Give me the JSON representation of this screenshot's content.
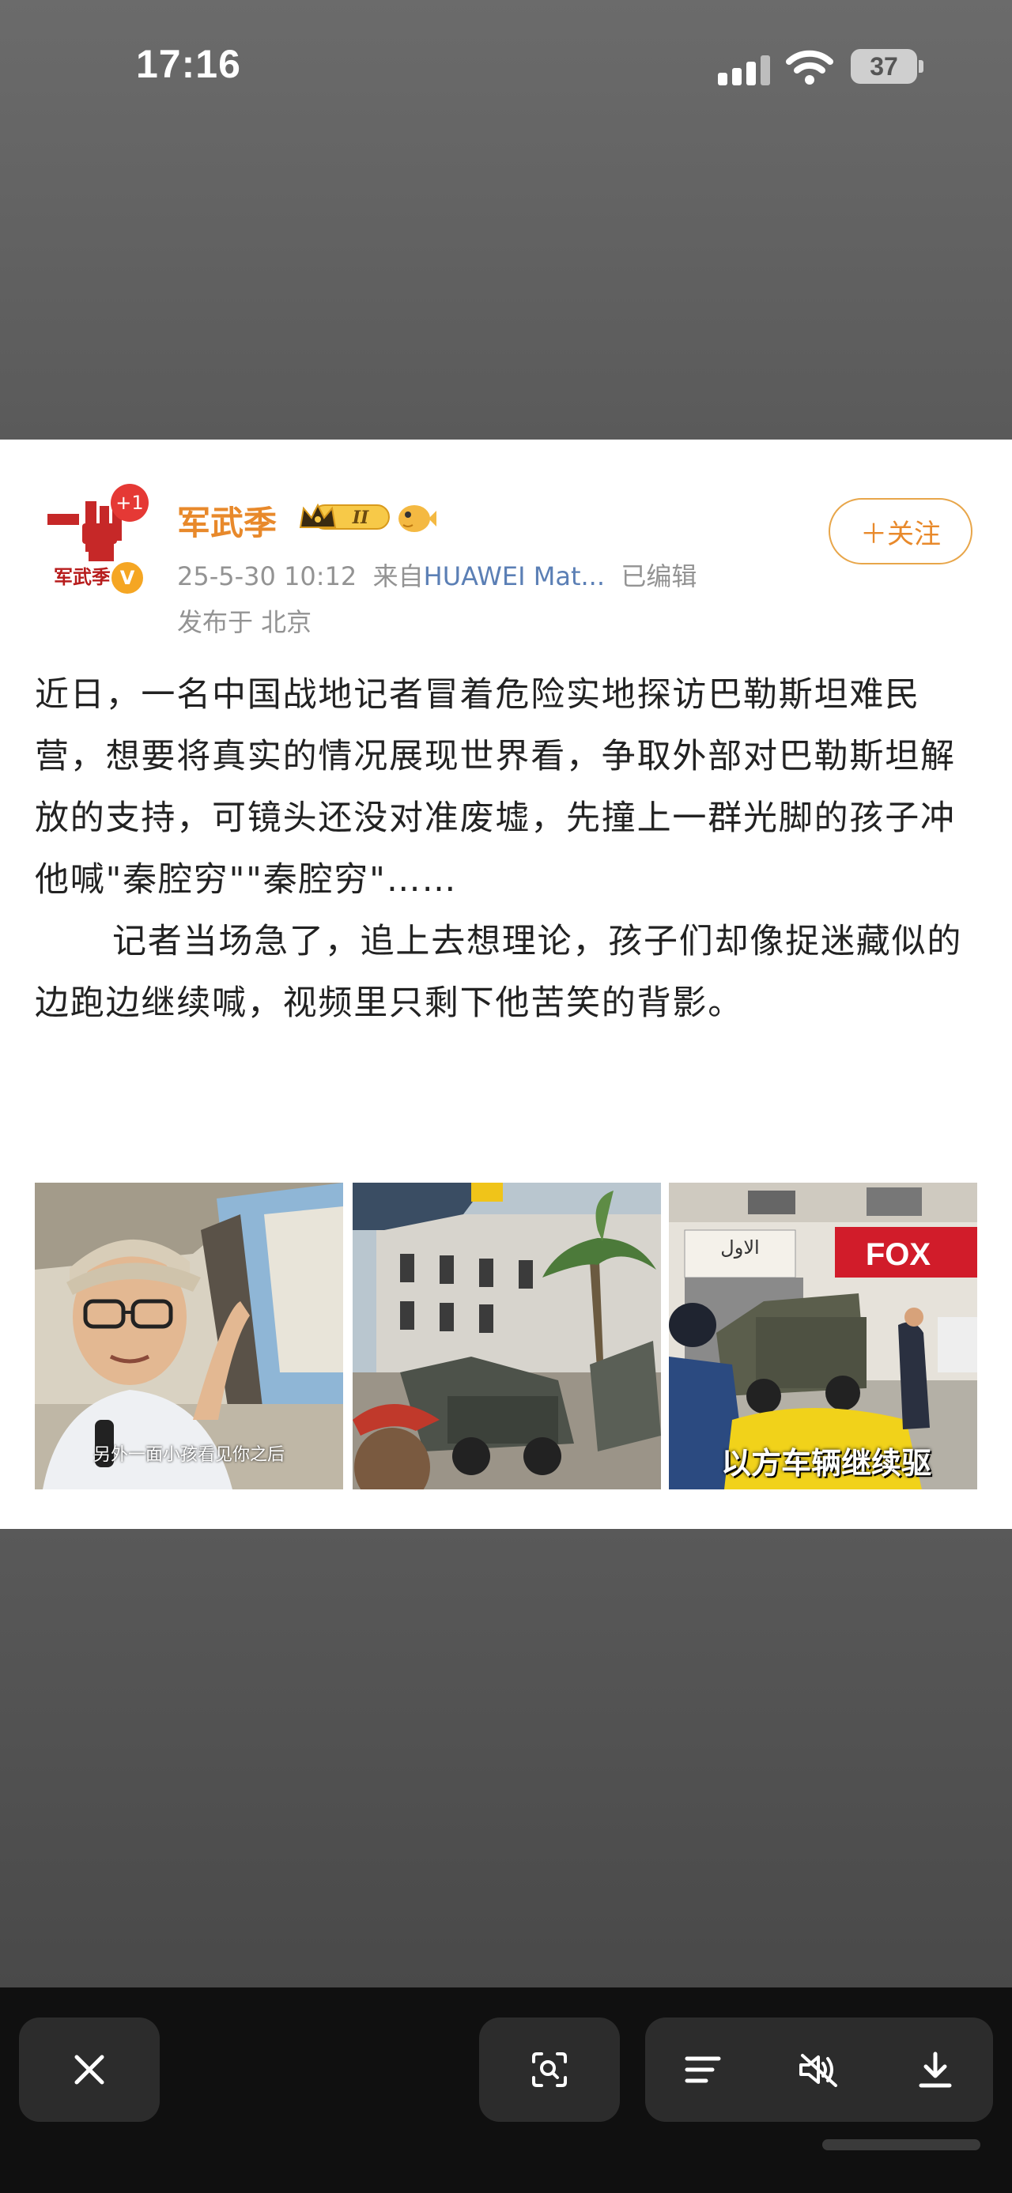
{
  "status_bar": {
    "time": "17:16",
    "battery": "37",
    "signal_icon": "cellular-signal-icon",
    "wifi_icon": "wifi-icon"
  },
  "post": {
    "author": "军武季",
    "avatar_notification": "+1",
    "avatar_text": "军武季",
    "meta": {
      "date": "25-5-30 10:12",
      "source_prefix": "来自",
      "device": "HUAWEI Mat...",
      "edited": "已编辑"
    },
    "location": "发布于 北京",
    "follow_label": "＋关注",
    "badge_level": "II",
    "body": [
      "近日，一名中国战地记者冒着危险实地探访巴勒斯坦难民营，想要将真实的情况展现世界看，争取外部对巴勒斯坦解放的支持，可镜头还没对准废墟，先撞上一群光脚的孩子冲他喊\"秦腔穷\"\"秦腔穷\"……",
      "记者当场急了，追上去想理论，孩子们却像捉迷藏似的边跑边继续喊，视频里只剩下他苦笑的背影。"
    ],
    "images": [
      {
        "caption": "另外一面小孩看见你之后"
      },
      {
        "caption": ""
      },
      {
        "caption": "以方车辆继续驱",
        "sign_text": "FOX",
        "arabic_sign": "الاول"
      }
    ]
  },
  "toolbar": {
    "close_icon": "close-icon",
    "scan_icon": "scan-text-icon",
    "menu_icon": "menu-icon",
    "mute_icon": "mute-icon",
    "download_icon": "download-icon"
  },
  "colors": {
    "accent": "#e8892b",
    "background": "#595959",
    "toolbar": "#101010"
  }
}
